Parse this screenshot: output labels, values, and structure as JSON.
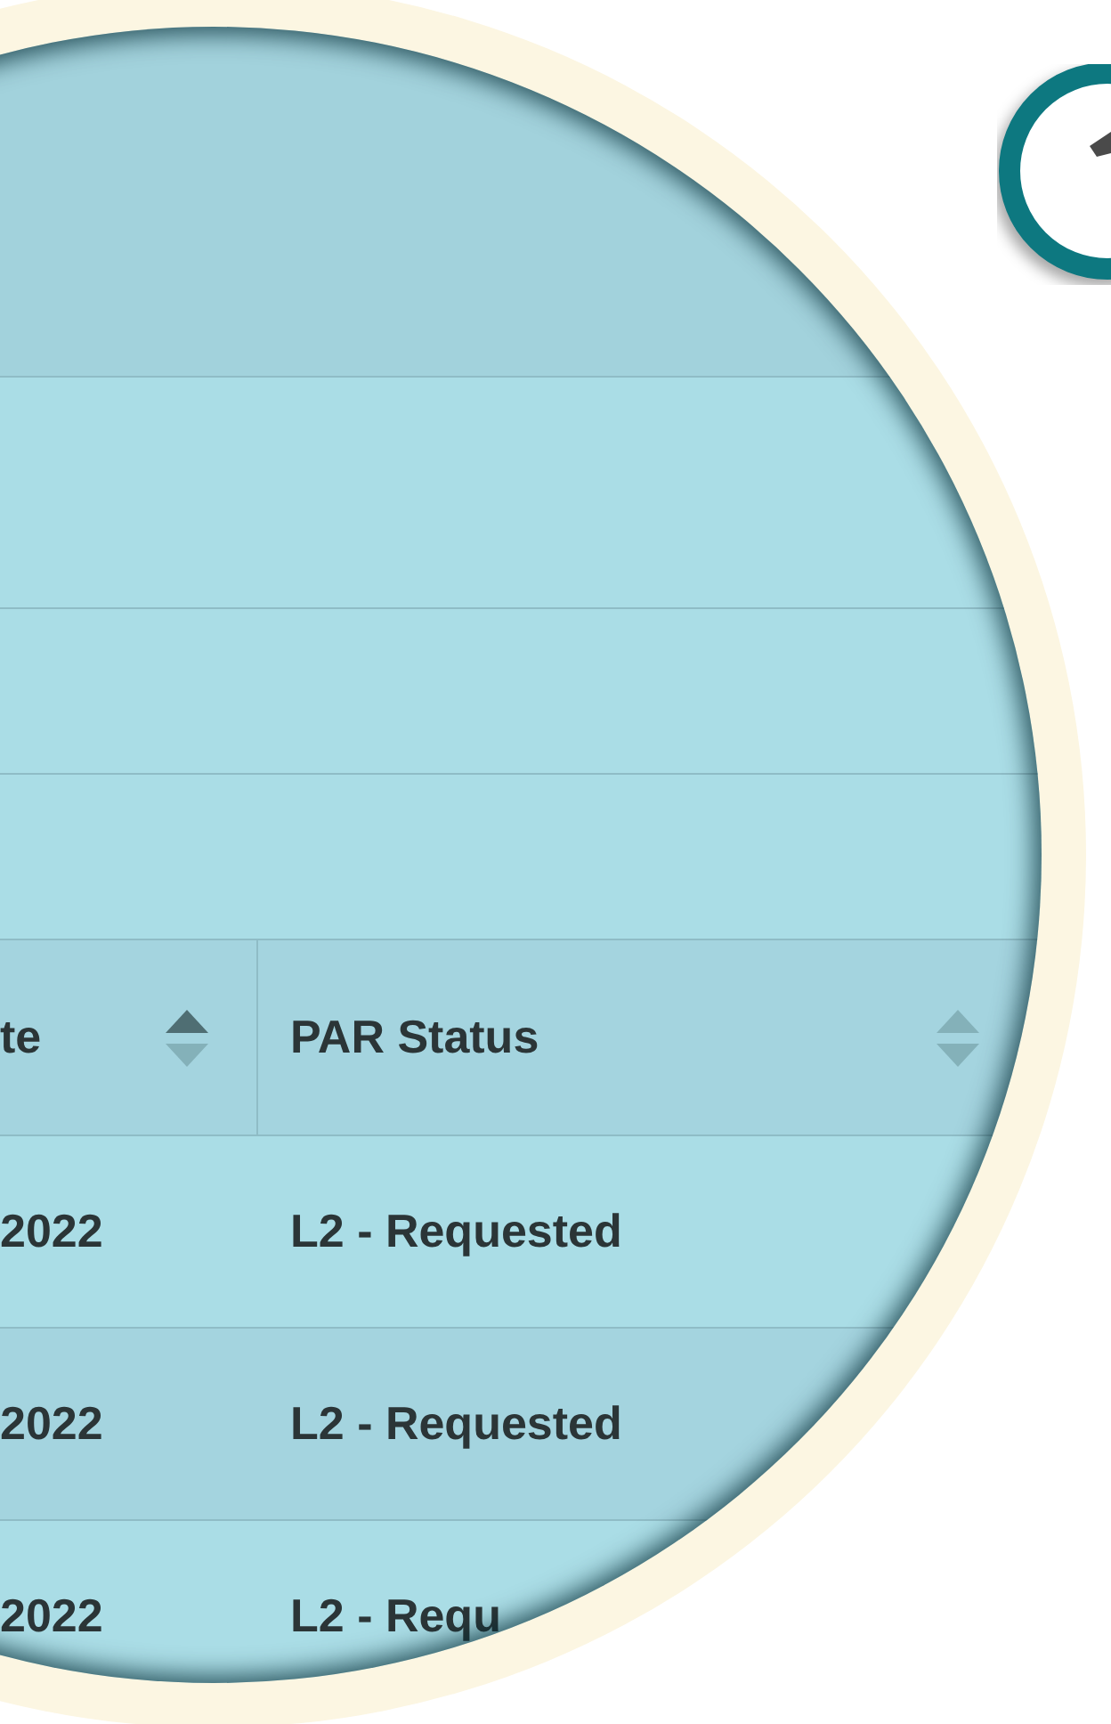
{
  "table": {
    "columns": [
      {
        "label": "te",
        "sorted_ascending": true
      },
      {
        "label": "PAR Status",
        "sorted_ascending": false
      }
    ],
    "rows": [
      {
        "cells": [
          "2022",
          "L2 - Requested"
        ]
      },
      {
        "cells": [
          "2022",
          "L2 - Requested"
        ]
      },
      {
        "cells": [
          "2022",
          "L2 - Requ"
        ]
      }
    ]
  }
}
